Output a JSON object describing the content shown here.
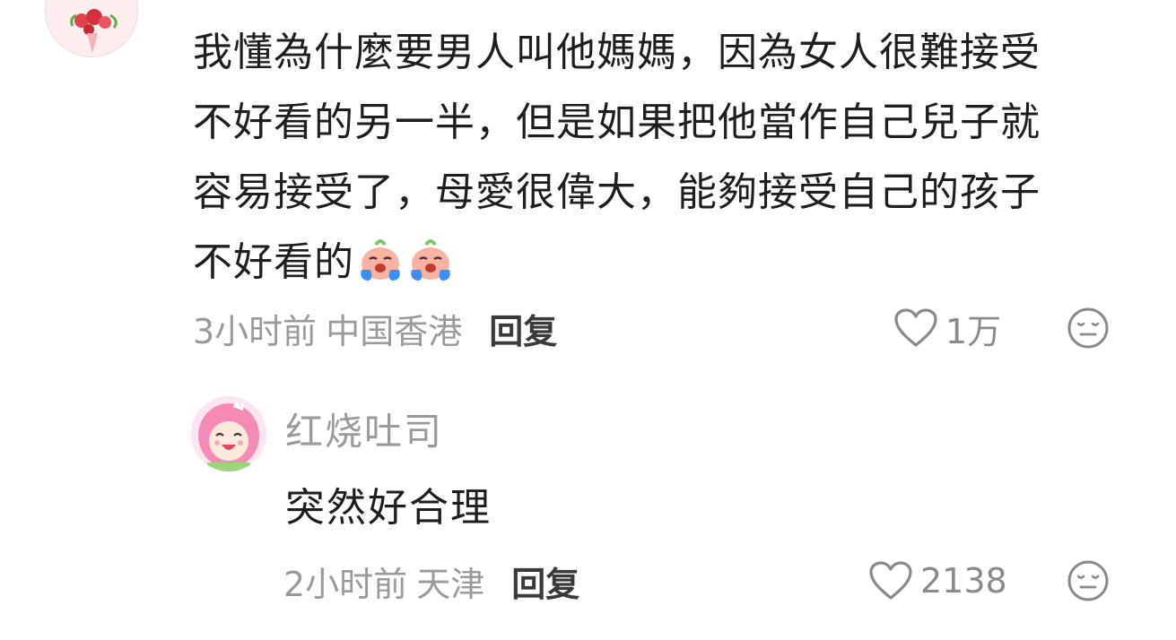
{
  "comment": {
    "lines": [
      "我懂為什麼要男人叫他媽媽，因為女人很難接受",
      "不好看的另一半，但是如果把他當作自己兒子就",
      "容易接受了，母愛很偉大，能夠接受自己的孩子",
      "不好看的"
    ],
    "emoji": [
      "crying-face-emoji",
      "crying-face-emoji"
    ],
    "time": "3小时前",
    "location": "中国香港",
    "reply_label": "回复",
    "like_count": "1万"
  },
  "reply": {
    "username": "红烧吐司",
    "text": "突然好合理",
    "time": "2小时前",
    "location": "天津",
    "reply_label": "回复",
    "like_count": "2138"
  },
  "icons": {
    "like": "heart-outline-icon",
    "dislike": "neutral-face-icon"
  },
  "colors": {
    "text": "#1e1e1e",
    "meta": "#9a9a9a",
    "reply_action": "#3a3a3a",
    "emoji_face": "#f6a79a",
    "emoji_tear": "#3d8ef2"
  }
}
